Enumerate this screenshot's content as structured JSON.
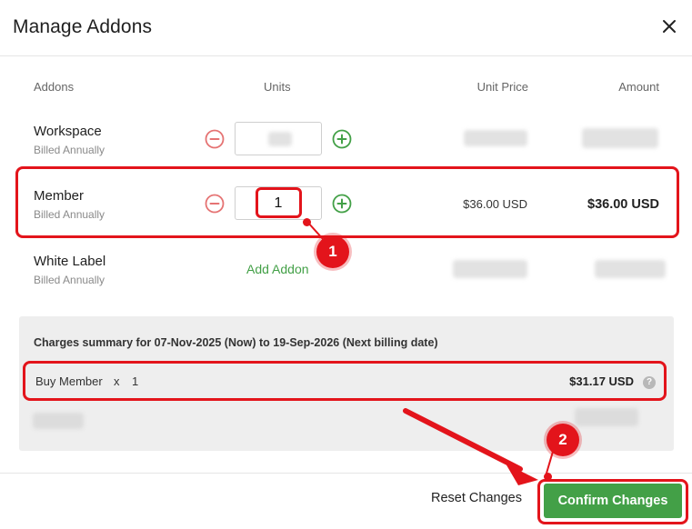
{
  "dialog": {
    "title": "Manage Addons",
    "close_icon": "close-icon"
  },
  "table": {
    "headers": [
      "Addons",
      "Units",
      "Unit Price",
      "Amount"
    ],
    "rows": [
      {
        "name": "Workspace",
        "billing": "Billed Annually",
        "units": "",
        "unit_price": "",
        "amount": ""
      },
      {
        "name": "Member",
        "billing": "Billed Annually",
        "units": "1",
        "unit_price": "$36.00 USD",
        "amount": "$36.00 USD"
      },
      {
        "name": "White Label",
        "billing": "Billed Annually",
        "action": "Add Addon",
        "unit_price": "",
        "amount": ""
      }
    ]
  },
  "summary": {
    "title": "Charges summary for 07-Nov-2025 (Now) to 19-Sep-2026 (Next billing date)",
    "line": {
      "label": "Buy Member",
      "times": "x",
      "qty": "1",
      "amount": "$31.17 USD",
      "help_icon": "help-icon"
    }
  },
  "footer": {
    "reset_label": "Reset Changes",
    "confirm_label": "Confirm Changes"
  },
  "annotations": {
    "step1": "1",
    "step2": "2"
  },
  "colors": {
    "accent_green": "#43a047",
    "minus_red": "#e57373",
    "annotation_red": "#e3141b"
  }
}
